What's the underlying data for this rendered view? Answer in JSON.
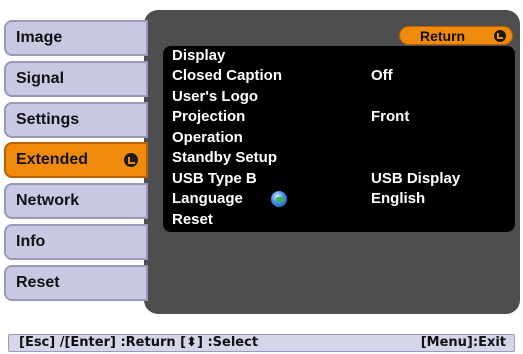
{
  "sidebar": {
    "items": [
      {
        "label": "Image"
      },
      {
        "label": "Signal"
      },
      {
        "label": "Settings"
      },
      {
        "label": "Extended",
        "active": true
      },
      {
        "label": "Network"
      },
      {
        "label": "Info"
      },
      {
        "label": "Reset"
      }
    ]
  },
  "panel": {
    "return_label": "Return",
    "rows": [
      {
        "label": "Display",
        "value": ""
      },
      {
        "label": "Closed Caption",
        "value": "Off"
      },
      {
        "label": "User's Logo",
        "value": ""
      },
      {
        "label": "Projection",
        "value": "Front"
      },
      {
        "label": "Operation",
        "value": ""
      },
      {
        "label": "Standby Setup",
        "value": ""
      },
      {
        "label": "USB Type B",
        "value": "USB Display"
      },
      {
        "label": "Language",
        "value": "English",
        "icon": "globe-icon"
      },
      {
        "label": "Reset",
        "value": ""
      }
    ]
  },
  "footer": {
    "left": "[Esc] /[Enter] :Return  [⬍] :Select",
    "right": "[Menu]:Exit"
  },
  "colors": {
    "accent": "#f08a0c",
    "tab_bg": "#c8c8e2",
    "panel_bg": "#4e4e4e",
    "list_bg": "#000000"
  }
}
